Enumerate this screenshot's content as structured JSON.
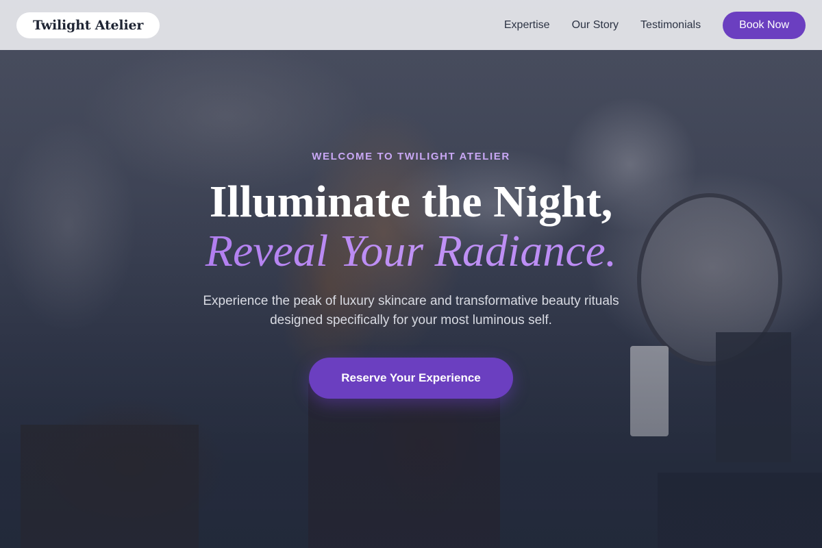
{
  "navbar": {
    "brand": "Twilight Atelier",
    "links": [
      "Expertise",
      "Our Story",
      "Testimonials"
    ],
    "cta_label": "Book Now"
  },
  "hero": {
    "eyebrow": "WELCOME TO TWILIGHT ATELIER",
    "headline_line1": "Illuminate the Night,",
    "headline_line2": "Reveal Your Radiance.",
    "subtitle": "Experience the peak of luxury skincare and transformative beauty rituals designed specifically for your most luminous self.",
    "cta_label": "Reserve Your Experience"
  },
  "colors": {
    "accent": "#6b3fc0",
    "accent_light": "#c9a8f5",
    "headline_gradient": "#b07ef0",
    "navbar_bg": "#e6e7eb"
  }
}
